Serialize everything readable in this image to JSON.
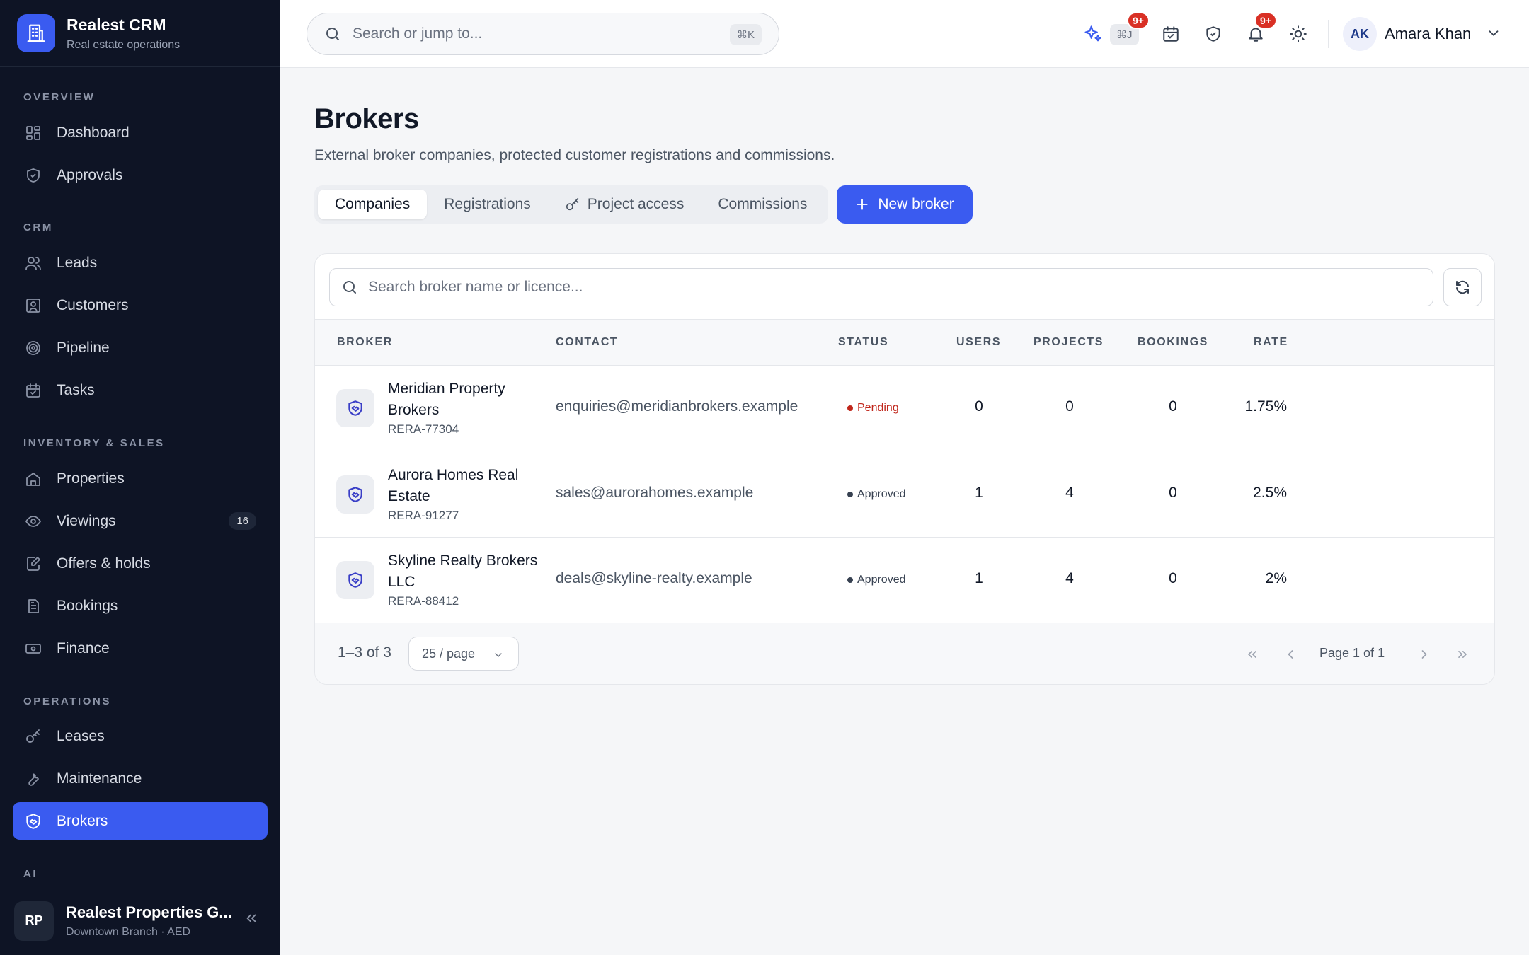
{
  "app": {
    "name": "Realest CRM",
    "subtitle": "Real estate operations"
  },
  "sidebar": {
    "sections": [
      {
        "label": "OVERVIEW"
      },
      {
        "label": "CRM"
      },
      {
        "label": "INVENTORY & SALES"
      },
      {
        "label": "OPERATIONS"
      },
      {
        "label": "AI"
      }
    ],
    "items": [
      {
        "label": "Dashboard",
        "icon": "grid-icon"
      },
      {
        "label": "Approvals",
        "icon": "shield-check-icon"
      },
      {
        "label": "Leads",
        "icon": "users-icon"
      },
      {
        "label": "Customers",
        "icon": "contact-icon"
      },
      {
        "label": "Pipeline",
        "icon": "target-icon"
      },
      {
        "label": "Tasks",
        "icon": "calendar-check-icon"
      },
      {
        "label": "Properties",
        "icon": "home-icon"
      },
      {
        "label": "Viewings",
        "icon": "eye-icon",
        "badge": "16"
      },
      {
        "label": "Offers & holds",
        "icon": "edit-icon"
      },
      {
        "label": "Bookings",
        "icon": "document-icon"
      },
      {
        "label": "Finance",
        "icon": "banknote-icon"
      },
      {
        "label": "Leases",
        "icon": "key-icon"
      },
      {
        "label": "Maintenance",
        "icon": "wrench-icon"
      },
      {
        "label": "Brokers",
        "icon": "handshake-icon",
        "active": true
      }
    ],
    "org": {
      "initials": "RP",
      "name": "Realest Properties G...",
      "sub": "Downtown Branch · AED"
    }
  },
  "topbar": {
    "search_placeholder": "Search or jump to...",
    "search_shortcut": "⌘K",
    "ai_shortcut": "⌘J",
    "ai_badge": "9+",
    "notif_badge": "9+",
    "user": {
      "initials": "AK",
      "name": "Amara Khan"
    }
  },
  "page": {
    "title": "Brokers",
    "subtitle": "External broker companies, protected customer registrations and commissions.",
    "tabs": [
      {
        "label": "Companies",
        "active": true
      },
      {
        "label": "Registrations"
      },
      {
        "label": "Project access"
      },
      {
        "label": "Commissions"
      }
    ],
    "new_button": "New broker"
  },
  "table": {
    "search_placeholder": "Search broker name or licence...",
    "columns": [
      "BROKER",
      "CONTACT",
      "STATUS",
      "USERS",
      "PROJECTS",
      "BOOKINGS",
      "RATE"
    ],
    "rows": [
      {
        "name": "Meridian Property Brokers",
        "licence": "RERA-77304",
        "contact": "enquiries@meridianbrokers.example",
        "status": "Pending",
        "users": "0",
        "projects": "0",
        "bookings": "0",
        "rate": "1.75%"
      },
      {
        "name": "Aurora Homes Real Estate",
        "licence": "RERA-91277",
        "contact": "sales@aurorahomes.example",
        "status": "Approved",
        "users": "1",
        "projects": "4",
        "bookings": "0",
        "rate": "2.5%"
      },
      {
        "name": "Skyline Realty Brokers LLC",
        "licence": "RERA-88412",
        "contact": "deals@skyline-realty.example",
        "status": "Approved",
        "users": "1",
        "projects": "4",
        "bookings": "0",
        "rate": "2%"
      }
    ],
    "footer": {
      "range": "1–3 of 3",
      "page_size": "25 / page",
      "page_info": "Page 1 of 1"
    }
  },
  "colors": {
    "accent": "#3a5bf0",
    "sidebar_bg": "#0e1425",
    "pending": "#c0261b",
    "approved": "#374151",
    "badge": "#d93025"
  }
}
